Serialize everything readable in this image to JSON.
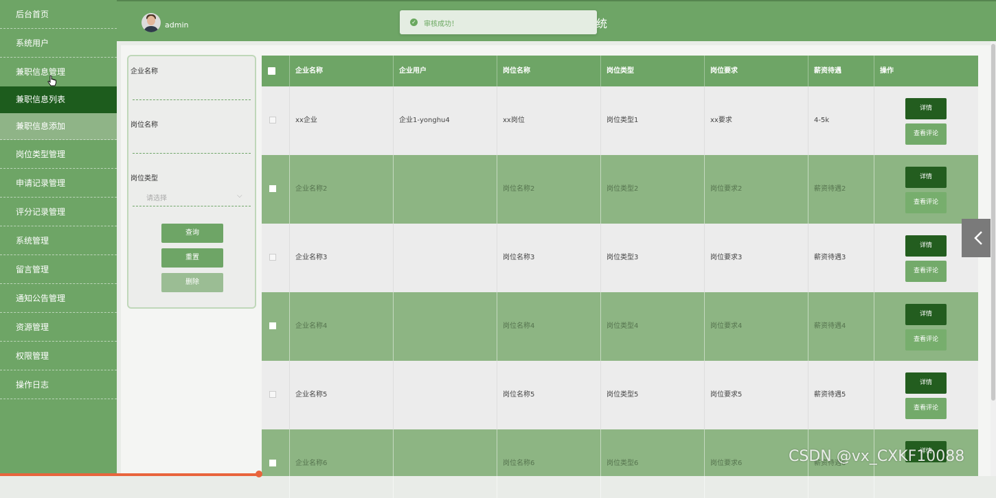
{
  "sidebar": {
    "items": [
      {
        "label": "后台首页"
      },
      {
        "label": "系统用户"
      },
      {
        "label": "兼职信息管理"
      },
      {
        "label": "兼职信息列表"
      },
      {
        "label": "兼职信息添加"
      },
      {
        "label": "岗位类型管理"
      },
      {
        "label": "申请记录管理"
      },
      {
        "label": "评分记录管理"
      },
      {
        "label": "系统管理"
      },
      {
        "label": "留言管理"
      },
      {
        "label": "通知公告管理"
      },
      {
        "label": "资源管理"
      },
      {
        "label": "权限管理"
      },
      {
        "label": "操作日志"
      }
    ]
  },
  "header": {
    "username": "admin",
    "title_partial": "统"
  },
  "toast": {
    "message": "审核成功！"
  },
  "search": {
    "company_label": "企业名称",
    "job_label": "岗位名称",
    "type_label": "岗位类型",
    "type_placeholder": "请选择",
    "query_button": "查询",
    "reset_button": "重置",
    "delete_button": "删除"
  },
  "table": {
    "columns": [
      "企业名称",
      "企业用户",
      "岗位名称",
      "岗位类型",
      "岗位要求",
      "薪资待遇",
      "操作"
    ],
    "detail_label": "详情",
    "review_label": "查看评论",
    "rows": [
      {
        "company": "xx企业",
        "user": "企业1-yonghu4",
        "job": "xx岗位",
        "type": "岗位类型1",
        "req": "xx要求",
        "salary": "4-5k"
      },
      {
        "company": "企业名称2",
        "user": "",
        "job": "岗位名称2",
        "type": "岗位类型2",
        "req": "岗位要求2",
        "salary": "薪资待遇2"
      },
      {
        "company": "企业名称3",
        "user": "",
        "job": "岗位名称3",
        "type": "岗位类型3",
        "req": "岗位要求3",
        "salary": "薪资待遇3"
      },
      {
        "company": "企业名称4",
        "user": "",
        "job": "岗位名称4",
        "type": "岗位类型4",
        "req": "岗位要求4",
        "salary": "薪资待遇4"
      },
      {
        "company": "企业名称5",
        "user": "",
        "job": "岗位名称5",
        "type": "岗位类型5",
        "req": "岗位要求5",
        "salary": "薪资待遇5"
      },
      {
        "company": "企业名称6",
        "user": "",
        "job": "岗位名称6",
        "type": "岗位类型6",
        "req": "岗位要求6",
        "salary": "薪资待遇6"
      }
    ]
  },
  "watermark": "CSDN @vx_CXKF10088",
  "colors": {
    "primary": "#6ea566",
    "dark_green": "#235d1f",
    "row_dark": "#8db583"
  }
}
